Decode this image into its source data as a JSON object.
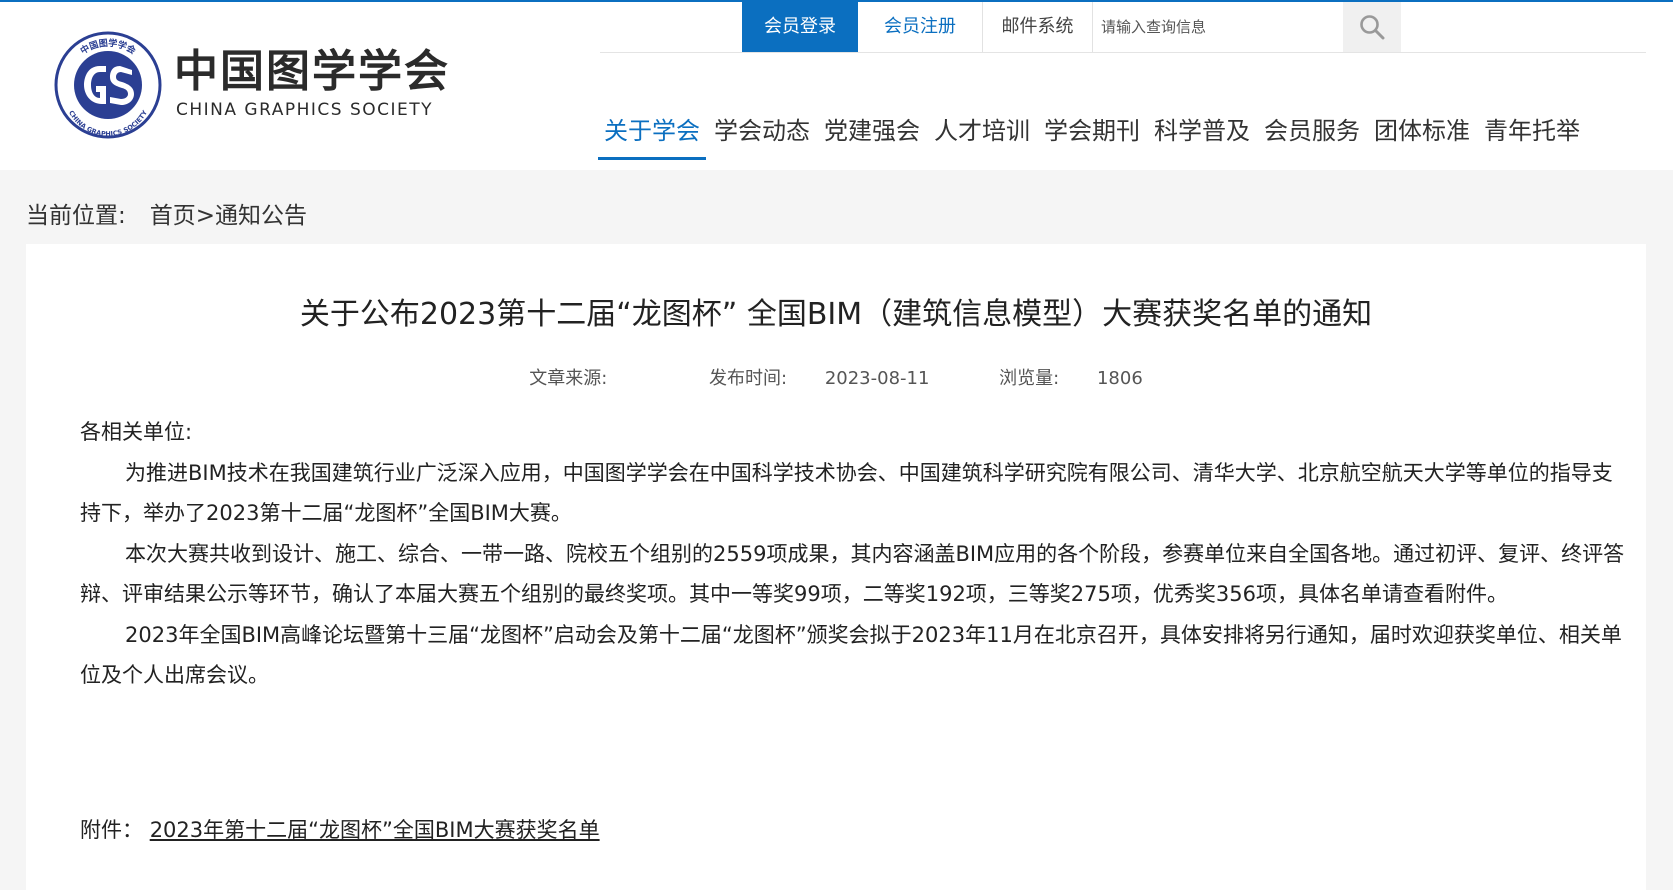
{
  "logo": {
    "cn": "中国图学学会",
    "en": "CHINA GRAPHICS SOCIETY",
    "emblem_text_top": "中国图学学会",
    "emblem_text_bottom": "CHINA GRAPHICS SOCIETY"
  },
  "utility": {
    "login": "会员登录",
    "register": "会员注册",
    "mail": "邮件系统",
    "search_placeholder": "请输入查询信息"
  },
  "nav": {
    "items": [
      "关于学会",
      "学会动态",
      "党建强会",
      "人才培训",
      "学会期刊",
      "科学普及",
      "会员服务",
      "团体标准",
      "青年托举"
    ],
    "active_index": 0
  },
  "breadcrumb": {
    "label": "当前位置:",
    "home": "首页",
    "separator": ">",
    "current": "通知公告"
  },
  "article": {
    "title": "关于公布2023第十二届“龙图杯” 全国BIM（建筑信息模型）大赛获奖名单的通知",
    "source_label": "文章来源:",
    "source_value": "",
    "date_label": "发布时间:",
    "date_value": "2023-08-11",
    "views_label": "浏览量:",
    "views_value": "1806",
    "greeting": "各相关单位:",
    "paragraphs": [
      "为推进BIM技术在我国建筑行业广泛深入应用，中国图学学会在中国科学技术协会、中国建筑科学研究院有限公司、清华大学、北京航空航天大学等单位的指导支持下，举办了2023第十二届“龙图杯”全国BIM大赛。",
      "本次大赛共收到设计、施工、综合、一带一路、院校五个组别的2559项成果，其内容涵盖BIM应用的各个阶段，参赛单位来自全国各地。通过初评、复评、终评答辩、评审结果公示等环节，确认了本届大赛五个组别的最终奖项。其中一等奖99项，二等奖192项，三等奖275项，优秀奖356项，具体名单请查看附件。",
      "2023年全国BIM高峰论坛暨第十三届“龙图杯”启动会及第十二届“龙图杯”颁奖会拟于2023年11月在北京召开，具体安排将另行通知，届时欢迎获奖单位、相关单位及个人出席会议。"
    ],
    "attachment_label": "附件：",
    "attachment_link": "2023年第十二届“龙图杯”全国BIM大赛获奖名单"
  },
  "colors": {
    "accent": "#0b6fc0",
    "page_bg": "#f5f5f5",
    "emblem": "#2b3f93"
  },
  "icons": {
    "search": "search-icon",
    "emblem": "logo-emblem"
  }
}
